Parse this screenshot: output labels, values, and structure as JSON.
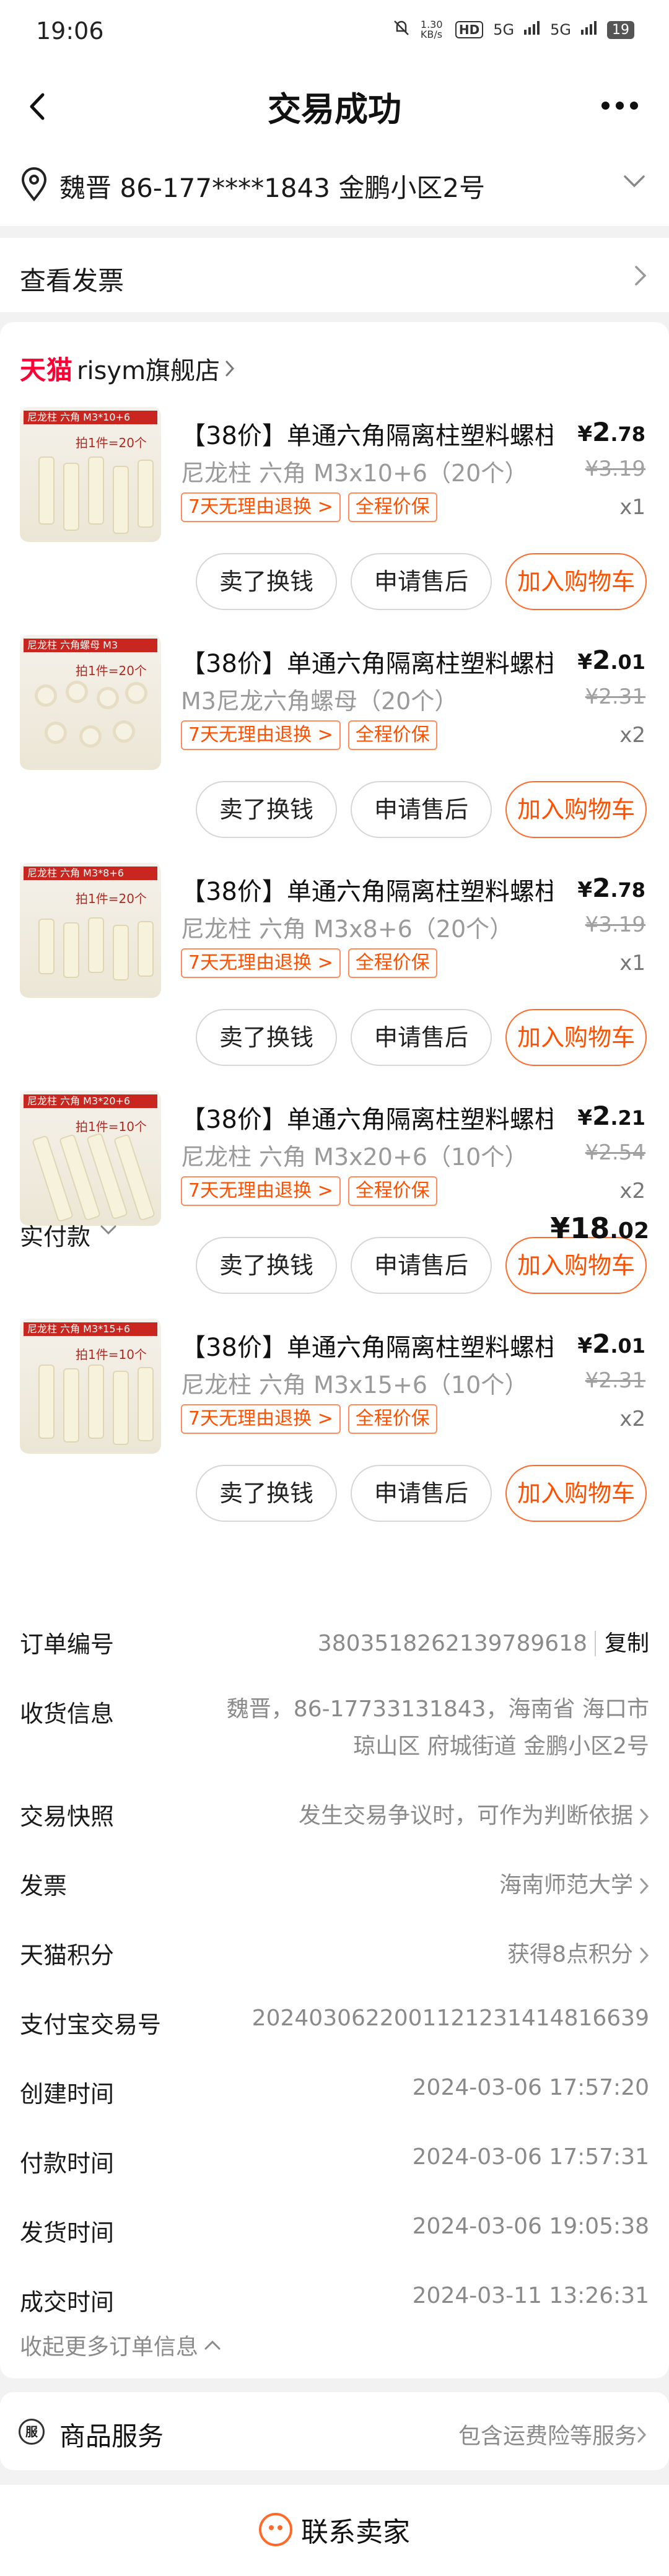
{
  "status_bar": {
    "time": "19:06",
    "net_speed": "1.30 KB/s",
    "hd": "HD",
    "signal1": "5G",
    "signal2": "5G",
    "battery": "19"
  },
  "header": {
    "title": "交易成功"
  },
  "address": {
    "text": "魏晋  86-177****1843  金鹏小区2号"
  },
  "invoice": {
    "label": "查看发票"
  },
  "store": {
    "platform": "天猫",
    "name": "risym旗舰店"
  },
  "items": [
    {
      "thumb_label": "尼龙柱 六角 M3*10+6",
      "thumb_qty": "拍1件=20个",
      "title": "【38价】单通六角隔离柱塑料螺柱",
      "spec": "尼龙柱 六角 M3x10+6（20个）",
      "tags": [
        "7天无理由退换 >",
        "全程价保"
      ],
      "currency": "¥",
      "price_int": "2",
      "price_dec": ".78",
      "orig_price": "¥3.19",
      "count": "x1",
      "buttons": [
        "卖了换钱",
        "申请售后",
        "加入购物车"
      ]
    },
    {
      "thumb_label": "尼龙柱 六角螺母 M3",
      "thumb_qty": "拍1件=20个",
      "title": "【38价】单通六角隔离柱塑料螺柱",
      "spec": "M3尼龙六角螺母（20个）",
      "tags": [
        "7天无理由退换 >",
        "全程价保"
      ],
      "currency": "¥",
      "price_int": "2",
      "price_dec": ".01",
      "orig_price": "¥2.31",
      "count": "x2",
      "buttons": [
        "卖了换钱",
        "申请售后",
        "加入购物车"
      ]
    },
    {
      "thumb_label": "尼龙柱 六角 M3*8+6",
      "thumb_qty": "拍1件=20个",
      "title": "【38价】单通六角隔离柱塑料螺柱",
      "spec": "尼龙柱 六角 M3x8+6（20个）",
      "tags": [
        "7天无理由退换 >",
        "全程价保"
      ],
      "currency": "¥",
      "price_int": "2",
      "price_dec": ".78",
      "orig_price": "¥3.19",
      "count": "x1",
      "buttons": [
        "卖了换钱",
        "申请售后",
        "加入购物车"
      ]
    },
    {
      "thumb_label": "尼龙柱 六角 M3*20+6",
      "thumb_qty": "拍1件=10个",
      "title": "【38价】单通六角隔离柱塑料螺柱",
      "spec": "尼龙柱 六角 M3x20+6（10个）",
      "tags": [
        "7天无理由退换 >",
        "全程价保"
      ],
      "currency": "¥",
      "price_int": "2",
      "price_dec": ".21",
      "orig_price": "¥2.54",
      "count": "x2",
      "buttons": [
        "卖了换钱",
        "申请售后",
        "加入购物车"
      ]
    },
    {
      "thumb_label": "尼龙柱 六角 M3*15+6",
      "thumb_qty": "拍1件=10个",
      "title": "【38价】单通六角隔离柱塑料螺柱",
      "spec": "尼龙柱 六角 M3x15+6（10个）",
      "tags": [
        "7天无理由退换 >",
        "全程价保"
      ],
      "currency": "¥",
      "price_int": "2",
      "price_dec": ".01",
      "orig_price": "¥2.31",
      "count": "x2",
      "buttons": [
        "卖了换钱",
        "申请售后",
        "加入购物车"
      ]
    }
  ],
  "payment": {
    "label": "实付款",
    "currency": "¥",
    "amount_int": "18",
    "amount_dec": ".02"
  },
  "order_info": {
    "order_no_label": "订单编号",
    "order_no": "3803518262139789618",
    "copy_label": "复制",
    "shipping_label": "收货信息",
    "shipping_value": "魏晋，86-17733131843，海南省 海口市 琼山区 府城街道 金鹏小区2号",
    "snapshot_label": "交易快照",
    "snapshot_value": "发生交易争议时，可作为判断依据",
    "invoice_label": "发票",
    "invoice_value": "海南师范大学",
    "points_label": "天猫积分",
    "points_value": "获得8点积分",
    "alipay_label": "支付宝交易号",
    "alipay_value": "2024030622001121231414816639",
    "created_label": "创建时间",
    "created_value": "2024-03-06 17:57:20",
    "paid_label": "付款时间",
    "paid_value": "2024-03-06 17:57:31",
    "shipped_label": "发货时间",
    "shipped_value": "2024-03-06 19:05:38",
    "done_label": "成交时间",
    "done_value": "2024-03-11 13:26:31",
    "collapse_label": "收起更多订单信息"
  },
  "service": {
    "icon_text": "服",
    "label": "商品服务",
    "value": "包含运费险等服务"
  },
  "contact": {
    "label": "联系卖家"
  },
  "colors": {
    "accent": "#ff5000",
    "tmall": "#ff0036",
    "background": "#f2f2f2"
  }
}
